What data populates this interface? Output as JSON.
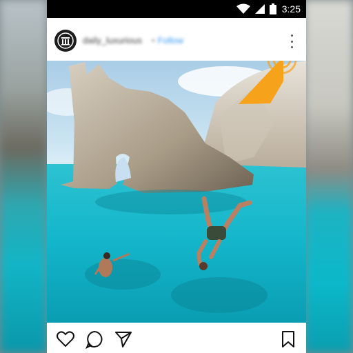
{
  "status_bar": {
    "time": "3:25",
    "icons": [
      "wifi-icon",
      "signal-icon",
      "battery-icon"
    ]
  },
  "post": {
    "username": "daily_luxurious",
    "follow_label": "Follow",
    "separator": "•",
    "avatar_icon": "building-logo-icon",
    "menu_icon": "more-vertical-icon",
    "photo_description_icon": "photo"
  },
  "actions": {
    "like_icon": "heart-icon",
    "comment_icon": "comment-icon",
    "share_icon": "send-icon",
    "save_icon": "bookmark-icon"
  },
  "colors": {
    "status_bar": "#000000",
    "follow_link": "#3897f0",
    "water": "#15b6ca",
    "gesture_hint": "#f7a21b"
  }
}
